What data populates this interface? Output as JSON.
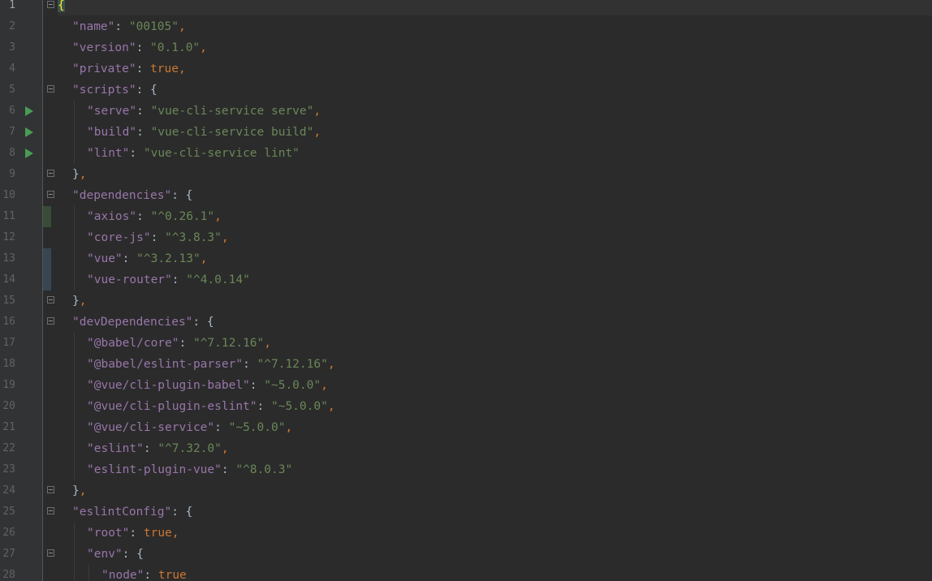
{
  "editor": {
    "language": "json",
    "lines": [
      {
        "n": "1",
        "fold": "open",
        "run": false,
        "change": "",
        "indent": 0,
        "tokens": [
          {
            "t": "{",
            "c": "brace-hl"
          }
        ]
      },
      {
        "n": "2",
        "fold": "",
        "run": false,
        "change": "",
        "indent": 1,
        "tokens": [
          {
            "t": "\"name\"",
            "c": "k"
          },
          {
            "t": ": ",
            "c": "p"
          },
          {
            "t": "\"00105\"",
            "c": "s"
          },
          {
            "t": ",",
            "c": "c"
          }
        ]
      },
      {
        "n": "3",
        "fold": "",
        "run": false,
        "change": "",
        "indent": 1,
        "tokens": [
          {
            "t": "\"version\"",
            "c": "k"
          },
          {
            "t": ": ",
            "c": "p"
          },
          {
            "t": "\"0.1.0\"",
            "c": "s"
          },
          {
            "t": ",",
            "c": "c"
          }
        ]
      },
      {
        "n": "4",
        "fold": "",
        "run": false,
        "change": "",
        "indent": 1,
        "tokens": [
          {
            "t": "\"private\"",
            "c": "k"
          },
          {
            "t": ": ",
            "c": "p"
          },
          {
            "t": "true",
            "c": "kw"
          },
          {
            "t": ",",
            "c": "c"
          }
        ]
      },
      {
        "n": "5",
        "fold": "open",
        "run": false,
        "change": "",
        "indent": 1,
        "tokens": [
          {
            "t": "\"scripts\"",
            "c": "k"
          },
          {
            "t": ": {",
            "c": "p"
          }
        ]
      },
      {
        "n": "6",
        "fold": "",
        "run": true,
        "change": "",
        "indent": 2,
        "tokens": [
          {
            "t": "\"serve\"",
            "c": "k"
          },
          {
            "t": ": ",
            "c": "p"
          },
          {
            "t": "\"vue-cli-service serve\"",
            "c": "s"
          },
          {
            "t": ",",
            "c": "c"
          }
        ]
      },
      {
        "n": "7",
        "fold": "",
        "run": true,
        "change": "",
        "indent": 2,
        "tokens": [
          {
            "t": "\"build\"",
            "c": "k"
          },
          {
            "t": ": ",
            "c": "p"
          },
          {
            "t": "\"vue-cli-service build\"",
            "c": "s"
          },
          {
            "t": ",",
            "c": "c"
          }
        ]
      },
      {
        "n": "8",
        "fold": "",
        "run": true,
        "change": "",
        "indent": 2,
        "tokens": [
          {
            "t": "\"lint\"",
            "c": "k"
          },
          {
            "t": ": ",
            "c": "p"
          },
          {
            "t": "\"vue-cli-service lint\"",
            "c": "s"
          }
        ]
      },
      {
        "n": "9",
        "fold": "close",
        "run": false,
        "change": "",
        "indent": 1,
        "tokens": [
          {
            "t": "}",
            "c": "p"
          },
          {
            "t": ",",
            "c": "c"
          }
        ]
      },
      {
        "n": "10",
        "fold": "open",
        "run": false,
        "change": "",
        "indent": 1,
        "tokens": [
          {
            "t": "\"dependencies\"",
            "c": "k"
          },
          {
            "t": ": {",
            "c": "p"
          }
        ]
      },
      {
        "n": "11",
        "fold": "",
        "run": false,
        "change": "added",
        "indent": 2,
        "tokens": [
          {
            "t": "\"axios\"",
            "c": "k"
          },
          {
            "t": ": ",
            "c": "p"
          },
          {
            "t": "\"^0.26.1\"",
            "c": "s"
          },
          {
            "t": ",",
            "c": "c"
          }
        ]
      },
      {
        "n": "12",
        "fold": "",
        "run": false,
        "change": "",
        "indent": 2,
        "tokens": [
          {
            "t": "\"core-js\"",
            "c": "k"
          },
          {
            "t": ": ",
            "c": "p"
          },
          {
            "t": "\"^3.8.3\"",
            "c": "s"
          },
          {
            "t": ",",
            "c": "c"
          }
        ]
      },
      {
        "n": "13",
        "fold": "",
        "run": false,
        "change": "modified",
        "indent": 2,
        "tokens": [
          {
            "t": "\"vue\"",
            "c": "k"
          },
          {
            "t": ": ",
            "c": "p"
          },
          {
            "t": "\"^3.2.13\"",
            "c": "s"
          },
          {
            "t": ",",
            "c": "c"
          }
        ]
      },
      {
        "n": "14",
        "fold": "",
        "run": false,
        "change": "modified",
        "indent": 2,
        "tokens": [
          {
            "t": "\"vue-router\"",
            "c": "k"
          },
          {
            "t": ": ",
            "c": "p"
          },
          {
            "t": "\"^4.0.14\"",
            "c": "s"
          }
        ]
      },
      {
        "n": "15",
        "fold": "close",
        "run": false,
        "change": "",
        "indent": 1,
        "tokens": [
          {
            "t": "}",
            "c": "p"
          },
          {
            "t": ",",
            "c": "c"
          }
        ]
      },
      {
        "n": "16",
        "fold": "open",
        "run": false,
        "change": "",
        "indent": 1,
        "tokens": [
          {
            "t": "\"devDependencies\"",
            "c": "k"
          },
          {
            "t": ": {",
            "c": "p"
          }
        ]
      },
      {
        "n": "17",
        "fold": "",
        "run": false,
        "change": "",
        "indent": 2,
        "tokens": [
          {
            "t": "\"@babel/core\"",
            "c": "k"
          },
          {
            "t": ": ",
            "c": "p"
          },
          {
            "t": "\"^7.12.16\"",
            "c": "s"
          },
          {
            "t": ",",
            "c": "c"
          }
        ]
      },
      {
        "n": "18",
        "fold": "",
        "run": false,
        "change": "",
        "indent": 2,
        "tokens": [
          {
            "t": "\"@babel/eslint-parser\"",
            "c": "k"
          },
          {
            "t": ": ",
            "c": "p"
          },
          {
            "t": "\"^7.12.16\"",
            "c": "s"
          },
          {
            "t": ",",
            "c": "c"
          }
        ]
      },
      {
        "n": "19",
        "fold": "",
        "run": false,
        "change": "",
        "indent": 2,
        "tokens": [
          {
            "t": "\"@vue/cli-plugin-babel\"",
            "c": "k"
          },
          {
            "t": ": ",
            "c": "p"
          },
          {
            "t": "\"~5.0.0\"",
            "c": "s"
          },
          {
            "t": ",",
            "c": "c"
          }
        ]
      },
      {
        "n": "20",
        "fold": "",
        "run": false,
        "change": "",
        "indent": 2,
        "tokens": [
          {
            "t": "\"@vue/cli-plugin-eslint\"",
            "c": "k"
          },
          {
            "t": ": ",
            "c": "p"
          },
          {
            "t": "\"~5.0.0\"",
            "c": "s"
          },
          {
            "t": ",",
            "c": "c"
          }
        ]
      },
      {
        "n": "21",
        "fold": "",
        "run": false,
        "change": "",
        "indent": 2,
        "tokens": [
          {
            "t": "\"@vue/cli-service\"",
            "c": "k"
          },
          {
            "t": ": ",
            "c": "p"
          },
          {
            "t": "\"~5.0.0\"",
            "c": "s"
          },
          {
            "t": ",",
            "c": "c"
          }
        ]
      },
      {
        "n": "22",
        "fold": "",
        "run": false,
        "change": "",
        "indent": 2,
        "tokens": [
          {
            "t": "\"eslint\"",
            "c": "k"
          },
          {
            "t": ": ",
            "c": "p"
          },
          {
            "t": "\"^7.32.0\"",
            "c": "s"
          },
          {
            "t": ",",
            "c": "c"
          }
        ]
      },
      {
        "n": "23",
        "fold": "",
        "run": false,
        "change": "",
        "indent": 2,
        "tokens": [
          {
            "t": "\"eslint-plugin-vue\"",
            "c": "k"
          },
          {
            "t": ": ",
            "c": "p"
          },
          {
            "t": "\"^8.0.3\"",
            "c": "s"
          }
        ]
      },
      {
        "n": "24",
        "fold": "close",
        "run": false,
        "change": "",
        "indent": 1,
        "tokens": [
          {
            "t": "}",
            "c": "p"
          },
          {
            "t": ",",
            "c": "c"
          }
        ]
      },
      {
        "n": "25",
        "fold": "open",
        "run": false,
        "change": "",
        "indent": 1,
        "tokens": [
          {
            "t": "\"eslintConfig\"",
            "c": "k"
          },
          {
            "t": ": {",
            "c": "p"
          }
        ]
      },
      {
        "n": "26",
        "fold": "",
        "run": false,
        "change": "",
        "indent": 2,
        "tokens": [
          {
            "t": "\"root\"",
            "c": "k"
          },
          {
            "t": ": ",
            "c": "p"
          },
          {
            "t": "true",
            "c": "kw"
          },
          {
            "t": ",",
            "c": "c"
          }
        ]
      },
      {
        "n": "27",
        "fold": "open",
        "run": false,
        "change": "",
        "indent": 2,
        "tokens": [
          {
            "t": "\"env\"",
            "c": "k"
          },
          {
            "t": ": {",
            "c": "p"
          }
        ]
      },
      {
        "n": "28",
        "fold": "",
        "run": false,
        "change": "",
        "indent": 3,
        "tokens": [
          {
            "t": "\"node\"",
            "c": "k"
          },
          {
            "t": ": ",
            "c": "p"
          },
          {
            "t": "true",
            "c": "kw"
          }
        ]
      }
    ],
    "colors": {
      "background": "#2b2b2b",
      "gutter": "#313335",
      "key": "#9876aa",
      "string": "#6a8759",
      "keyword": "#cc7832",
      "punctuation": "#a9b7c6",
      "line_number": "#606366",
      "run_icon": "#499c54",
      "added_marker": "#384c38",
      "modified_marker": "#374752"
    }
  }
}
